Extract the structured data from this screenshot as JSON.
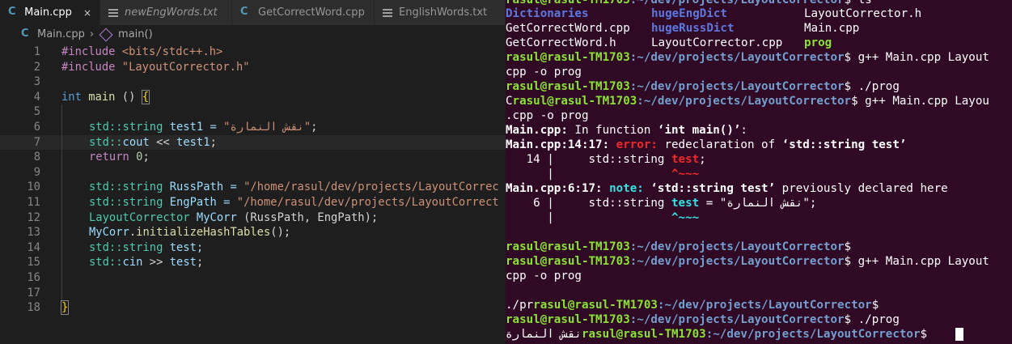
{
  "tabs": [
    {
      "label": "Main.cpp",
      "close": "×"
    },
    {
      "label": "newEngWords.txt"
    },
    {
      "label": "GetCorrectWord.cpp"
    },
    {
      "label": "EnglishWords.txt"
    }
  ],
  "breadcrumb": {
    "file": "Main.cpp",
    "sep": "›",
    "symbol": "main()"
  },
  "code": {
    "l1a": "#include ",
    "l1b": "<bits/stdc++.h>",
    "l2a": "#include ",
    "l2b": "\"LayoutCorrector.h\"",
    "l4a": "int",
    "l4b": " main ",
    "l4c": "() ",
    "l4d": "{",
    "l6a": "std::",
    "l6b": "string",
    "l6c": " test1 = ",
    "l6d": "\"نقش النمارة\"",
    "l6e": ";",
    "l7a": "std::",
    "l7b": "cout",
    "l7c": " << ",
    "l7d": "test1",
    "l7e": ";",
    "l8a": "return",
    "l8b": " 0",
    "l8c": ";",
    "l10a": "std::",
    "l10b": "string",
    "l10c": " RussPath = ",
    "l10d": "\"/home/rasul/dev/projects/LayoutCorrec",
    "l11a": "std::",
    "l11b": "string",
    "l11c": " EngPath = ",
    "l11d": "\"/home/rasul/dev/projects/LayoutCorrect",
    "l12a": "LayoutCorrector",
    "l12b": " MyCorr ",
    "l12c": "(RussPath, EngPath);",
    "l13a": "MyCorr",
    "l13b": ".",
    "l13c": "initializeHashTables",
    "l13d": "();",
    "l14a": "std::",
    "l14b": "string",
    "l14c": " test;",
    "l15a": "std::",
    "l15b": "cin",
    "l15c": " >> ",
    "l15d": "test",
    "l15e": ";",
    "l18a": "}"
  },
  "line_numbers": [
    "1",
    "2",
    "3",
    "4",
    "5",
    "6",
    "7",
    "8",
    "9",
    "10",
    "11",
    "12",
    "13",
    "14",
    "15",
    "16",
    "17",
    "18"
  ],
  "terminal": {
    "t0a": "rasul@rasul-TM1703",
    "t0b": ":~/dev/projects/LayoutCorrector",
    "t0c": "$ ls",
    "ls1a": "Dictionaries",
    "ls1b": "hugeEngDict",
    "ls1c": "LayoutCorrector.h",
    "ls2a": "GetCorrectWord.cpp",
    "ls2b": "hugeRussDict",
    "ls2c": "Main.cpp",
    "ls3a": "GetCorrectWord.h",
    "ls3b": "LayoutCorrector.cpp",
    "ls3c": "prog",
    "user": "rasul@rasul-TM1703",
    "path": ":~/dev/projects/LayoutCorrector",
    "cmd1": "$ g++ Main.cpp Layout",
    "cmd1b": "cpp -o prog",
    "cmd2": "$ ./prog",
    "c_prefix": "C",
    "cmd3": "$ g++ Main.cpp Layou",
    "cmd3b": ".cpp -o prog",
    "err1a": "Main.cpp:",
    "err1b": " In function ",
    "err1c": "‘int main()’",
    "err1d": ":",
    "err2a": "Main.cpp:14:17: ",
    "err2b": "error: ",
    "err2c": "redeclaration of ",
    "err2d": "‘std::string test’",
    "err3a": "   14 |     std::string ",
    "err3b": "test",
    "err3c": ";",
    "err4a": "      |                 ",
    "err4b": "^~~~",
    "err5a": "Main.cpp:6:17: ",
    "err5b": "note: ",
    "err5c": "‘std::string test’",
    "err5d": " previously declared here",
    "err6a": "    6 |     std::string ",
    "err6b": "test",
    "err6c": " = \"نقش النمارة\";",
    "err7a": "      |                 ",
    "err7b": "^~~~",
    "dollar": "$",
    "cmd4": "$ g++ Main.cpp Layout",
    "cmd4b": "cpp -o prog",
    "pr_prefix": "./pr",
    "cmd5": "$",
    "cmd6": "$ ./prog",
    "out_arabic": "نقش النمارة",
    "last": "$ "
  },
  "colors": {
    "editor_bg": "#1e1e1e",
    "terminal_bg": "#300a24",
    "prompt_green": "#8ae234",
    "prompt_blue": "#729fcf"
  }
}
